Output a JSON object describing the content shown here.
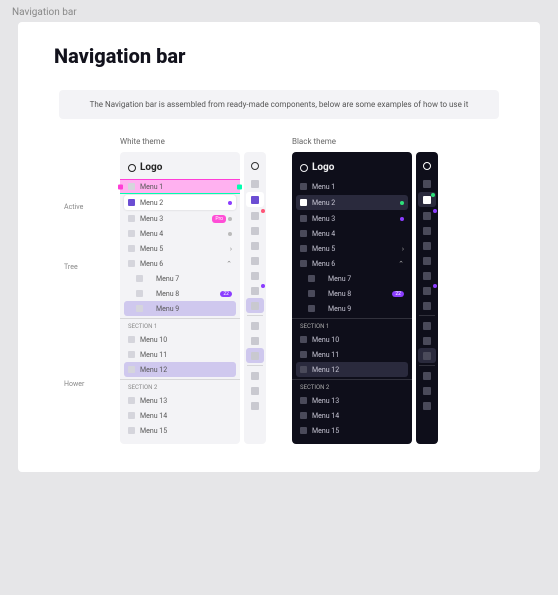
{
  "page_label": "Navigation bar",
  "title": "Navigation bar",
  "intro": "The Navigation bar is assembled from ready-made components, below are some examples of how to use it",
  "annotations": {
    "active": "Active",
    "tree": "Tree",
    "hower": "Hower"
  },
  "themes": {
    "white": "White theme",
    "black": "Black theme"
  },
  "logo": "Logo",
  "sections": {
    "s1": "SECTION 1",
    "s2": "SECTION 2"
  },
  "light": {
    "items": [
      {
        "label": "Menu 1",
        "state": "selected"
      },
      {
        "label": "Menu 2",
        "state": "active"
      },
      {
        "label": "Menu 3",
        "right": "pro-dot"
      },
      {
        "label": "Menu 4",
        "right": ""
      },
      {
        "label": "Menu 5",
        "right": "chev-right"
      },
      {
        "label": "Menu 6",
        "right": "chev-up"
      },
      {
        "label": "Menu 7",
        "indent": true
      },
      {
        "label": "Menu 8",
        "indent": true,
        "right": "num"
      },
      {
        "label": "Menu 9",
        "indent": true,
        "state": "hover"
      }
    ],
    "s1": [
      {
        "label": "Menu 10"
      },
      {
        "label": "Menu 11"
      },
      {
        "label": "Menu 12",
        "state": "hover"
      }
    ],
    "s2": [
      {
        "label": "Menu 13"
      },
      {
        "label": "Menu 14"
      },
      {
        "label": "Menu 15"
      }
    ],
    "badge_num": "22"
  },
  "dark": {
    "items": [
      {
        "label": "Menu 1"
      },
      {
        "label": "Menu 2",
        "state": "active",
        "right": "green"
      },
      {
        "label": "Menu 3",
        "right": "dot-on"
      },
      {
        "label": "Menu 4"
      },
      {
        "label": "Menu 5",
        "right": "chev-right"
      },
      {
        "label": "Menu 6",
        "right": "chev-up"
      },
      {
        "label": "Menu 7",
        "indent": true
      },
      {
        "label": "Menu 8",
        "indent": true,
        "right": "num"
      },
      {
        "label": "Menu 9",
        "indent": true
      }
    ],
    "s1": [
      {
        "label": "Menu 10"
      },
      {
        "label": "Menu 11"
      },
      {
        "label": "Menu 12",
        "state": "hover"
      }
    ],
    "s2": [
      {
        "label": "Menu 13"
      },
      {
        "label": "Menu 14"
      },
      {
        "label": "Menu 15"
      }
    ],
    "badge_num": "22"
  }
}
